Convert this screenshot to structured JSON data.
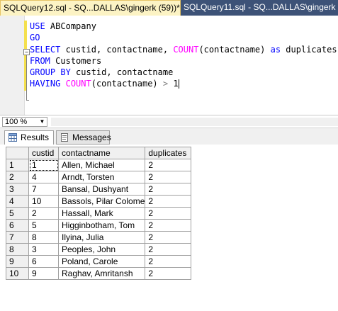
{
  "tabs": [
    {
      "label": "SQLQuery12.sql - SQ...DALLAS\\gingerk (59))*",
      "active": true
    },
    {
      "label": "SQLQuery11.sql - SQ...DALLAS\\gingerk (58))*",
      "active": false
    }
  ],
  "editor": {
    "lines": [
      [
        "USE",
        "ABCompany"
      ],
      [
        "GO"
      ],
      [
        "SELECT",
        "custid, contactname,",
        "COUNT",
        "(contactname)",
        "as",
        "duplicates"
      ],
      [
        "FROM",
        "Customers"
      ],
      [
        "GROUP BY",
        "custid, contactname"
      ],
      [
        "HAVING",
        "COUNT",
        "(contactname)",
        ">",
        "1"
      ]
    ]
  },
  "zoom": {
    "value": "100 %"
  },
  "results_tabs": {
    "results": "Results",
    "messages": "Messages"
  },
  "grid": {
    "columns": [
      "custid",
      "contactname",
      "duplicates"
    ],
    "rows": [
      [
        "1",
        "1",
        "Allen, Michael",
        "2"
      ],
      [
        "2",
        "4",
        "Arndt, Torsten",
        "2"
      ],
      [
        "3",
        "7",
        "Bansal, Dushyant",
        "2"
      ],
      [
        "4",
        "10",
        "Bassols, Pilar Colome",
        "2"
      ],
      [
        "5",
        "2",
        "Hassall, Mark",
        "2"
      ],
      [
        "6",
        "5",
        "Higginbotham, Tom",
        "2"
      ],
      [
        "7",
        "8",
        "Ilyina, Julia",
        "2"
      ],
      [
        "8",
        "3",
        "Peoples, John",
        "2"
      ],
      [
        "9",
        "6",
        "Poland, Carole",
        "2"
      ],
      [
        "10",
        "9",
        "Raghav, Amritansh",
        "2"
      ]
    ]
  },
  "icons": {
    "results_tab": "grid-icon",
    "messages_tab": "messages-icon",
    "zoom_dropdown": "chevron-down-icon"
  },
  "colors": {
    "tab_strip": "#2b3c59",
    "active_tab": "#fcf3c4",
    "keyword": "#0000ff",
    "function": "#ff00ff",
    "operator": "#808080",
    "change_bar": "#f4e04d"
  }
}
